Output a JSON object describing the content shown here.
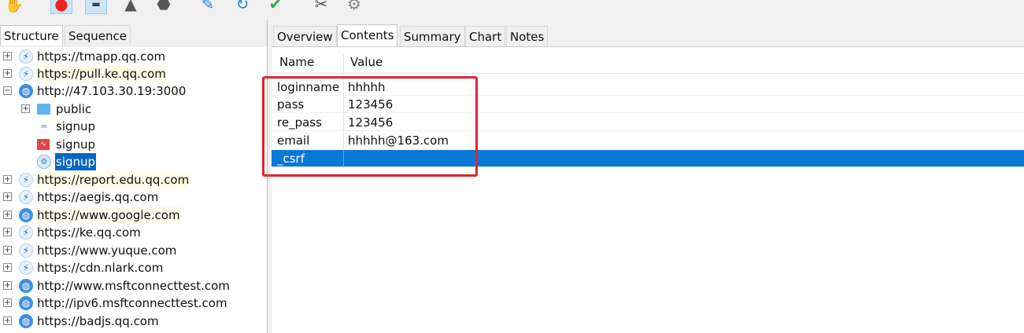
{
  "toolbar": {
    "icons": [
      "pointer-hand-icon",
      "record-icon",
      "throttle-icon",
      "clear-icon",
      "stop-icon",
      "edit-icon",
      "repeat-icon",
      "validate-icon",
      "tools-icon",
      "settings-icon"
    ]
  },
  "left_panel": {
    "tabs": [
      "Structure",
      "Sequence"
    ],
    "selected_tab": "Structure"
  },
  "tree": [
    {
      "label": "https://tmapp.qq.com",
      "icon": "bolt-icon"
    },
    {
      "label": "https://pull.ke.qq.com",
      "icon": "bolt-icon"
    },
    {
      "label": "http://47.103.30.19:3000",
      "icon": "globe-icon"
    },
    {
      "label": "public",
      "icon": "folder-icon"
    },
    {
      "label": "signup",
      "icon": "request-icon"
    },
    {
      "label": "signup",
      "icon": "response-icon"
    },
    {
      "label": "signup",
      "icon": "gear-icon"
    },
    {
      "label": "https://report.edu.qq.com",
      "icon": "bolt-icon"
    },
    {
      "label": "https://aegis.qq.com",
      "icon": "bolt-icon"
    },
    {
      "label": "https://www.google.com",
      "icon": "globe-icon"
    },
    {
      "label": "https://ke.qq.com",
      "icon": "bolt-icon"
    },
    {
      "label": "https://www.yuque.com",
      "icon": "bolt-icon"
    },
    {
      "label": "https://cdn.nlark.com",
      "icon": "bolt-icon"
    },
    {
      "label": "http://www.msftconnecttest.com",
      "icon": "globe-icon"
    },
    {
      "label": "http://ipv6.msftconnecttest.com",
      "icon": "globe-icon"
    },
    {
      "label": "https://badjs.qq.com",
      "icon": "globe-icon"
    }
  ],
  "right_panel": {
    "tabs": [
      "Overview",
      "Contents",
      "Summary",
      "Chart",
      "Notes"
    ],
    "selected_tab": "Contents"
  },
  "grid": {
    "headers": {
      "name": "Name",
      "value": "Value"
    },
    "rows": [
      {
        "name": "loginname",
        "value": "hhhhh"
      },
      {
        "name": "pass",
        "value": "123456"
      },
      {
        "name": "re_pass",
        "value": "123456"
      },
      {
        "name": "email",
        "value": "hhhhh@163.com"
      },
      {
        "name": "_csrf",
        "value": ""
      }
    ],
    "selected_row": "_csrf"
  },
  "colors": {
    "selection": "#0a78d7",
    "annotation": "#e52330",
    "host_highlight": "#fffde9"
  }
}
